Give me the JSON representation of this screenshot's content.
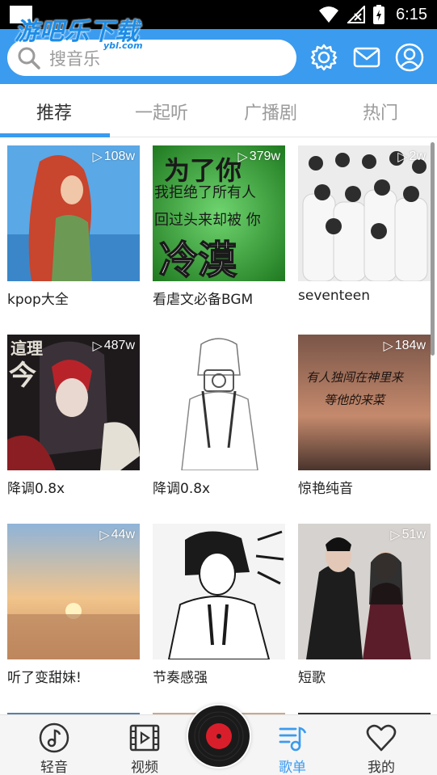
{
  "status_bar": {
    "time": "6:15"
  },
  "watermark": {
    "text": "游吧乐下载",
    "sub": "ybl.com"
  },
  "header": {
    "search_placeholder": "搜音乐"
  },
  "tabs": [
    {
      "label": "推荐",
      "active": true
    },
    {
      "label": "一起听",
      "active": false
    },
    {
      "label": "广播剧",
      "active": false
    },
    {
      "label": "热门",
      "active": false
    }
  ],
  "playlists": [
    {
      "title": "kpop大全",
      "plays": "108w",
      "cover_text": ""
    },
    {
      "title": "看虐文必备BGM",
      "plays": "379w",
      "cover_text": "为了你 我拒绝了所有人 回过头来却被你 冷漠"
    },
    {
      "title": "seventeen",
      "plays": "2w",
      "cover_text": ""
    },
    {
      "title": "降调0.8x",
      "plays": "487w",
      "cover_text": "這理 今 乐 超"
    },
    {
      "title": "降调0.8x",
      "plays": "",
      "cover_text": ""
    },
    {
      "title": "惊艳纯音",
      "plays": "184w",
      "cover_text": "有人独闯在神里来 等他的来菜"
    },
    {
      "title": "听了变甜妹!",
      "plays": "44w",
      "cover_text": ""
    },
    {
      "title": "节奏感强",
      "plays": "",
      "cover_text": ""
    },
    {
      "title": "短歌",
      "plays": "51w",
      "cover_text": ""
    }
  ],
  "bottom_nav": [
    {
      "label": "轻音",
      "icon": "music-note-icon",
      "active": false
    },
    {
      "label": "视频",
      "icon": "film-icon",
      "active": false
    },
    {
      "label": "歌单",
      "icon": "playlist-icon",
      "active": true
    },
    {
      "label": "我的",
      "icon": "heart-icon",
      "active": false
    }
  ],
  "colors": {
    "accent": "#3a9bef",
    "status_bar": "#000000"
  }
}
